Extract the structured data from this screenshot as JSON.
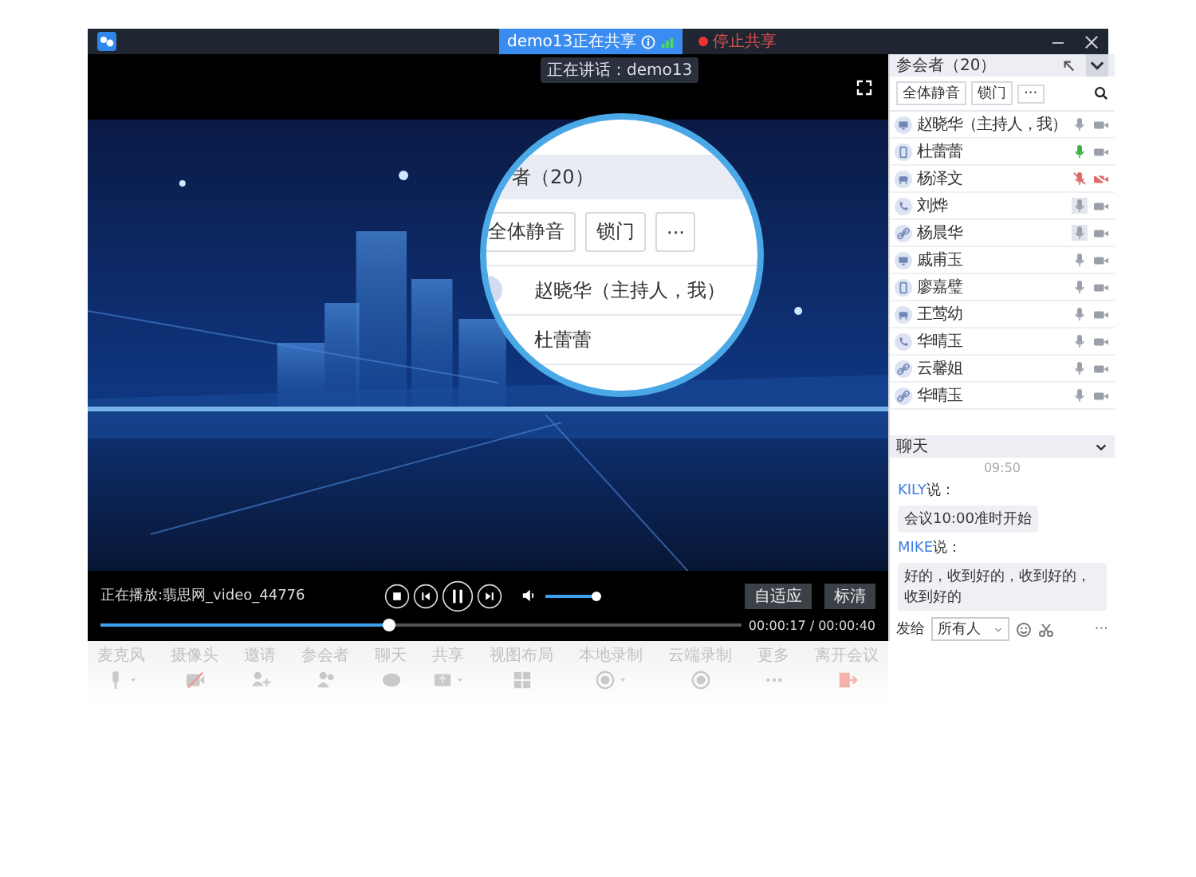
{
  "title_bar": {
    "sharing_label": "demo13正在共享",
    "tooltip": "正在讲话：demo13",
    "stop_share": "停止共享"
  },
  "video": {
    "now_playing": "正在播放:翡思网_video_44776",
    "progress": {
      "level": 0.45
    },
    "volume": {
      "level": 0.95
    },
    "time": "00:00:17 / 00:00:40",
    "buttons": [
      "自适应",
      "标清"
    ]
  },
  "magnifier": {
    "header": "者（20）",
    "buttons": [
      "全体静音",
      "锁门",
      "···"
    ],
    "rows": [
      "赵晓华（主持人，我）",
      "杜蕾蕾"
    ]
  },
  "toolbar": [
    {
      "label": "麦克风",
      "kind": "mic",
      "dropdown": true
    },
    {
      "label": "摄像头",
      "kind": "camera",
      "dropdown": false
    },
    {
      "label": "邀请",
      "kind": "invite",
      "dropdown": false
    },
    {
      "label": "参会者",
      "kind": "people",
      "dropdown": false
    },
    {
      "label": "聊天",
      "kind": "chat",
      "dropdown": false
    },
    {
      "label": "共享",
      "kind": "share",
      "dropdown": true
    },
    {
      "label": "视图布局",
      "kind": "layout",
      "dropdown": false
    },
    {
      "label": "本地录制",
      "kind": "record",
      "dropdown": true
    },
    {
      "label": "云端录制",
      "kind": "record",
      "dropdown": false
    },
    {
      "label": "更多",
      "kind": "more",
      "dropdown": false
    },
    {
      "label": "离开会议",
      "kind": "leave",
      "dropdown": false
    }
  ],
  "participants": {
    "title": "参会者（20）",
    "buttons": [
      "全体静音",
      "锁门",
      "···"
    ],
    "items": [
      {
        "name": "赵晓华（主持人，我）",
        "kind": "pc",
        "muted": false,
        "speaking": false,
        "highlighted": false,
        "camera_off": false
      },
      {
        "name": "杜蕾蕾",
        "kind": "mobile",
        "muted": false,
        "speaking": true,
        "highlighted": false,
        "camera_off": false
      },
      {
        "name": "杨泽文",
        "kind": "room",
        "muted": true,
        "speaking": false,
        "highlighted": false,
        "camera_off": true
      },
      {
        "name": "刘烨",
        "kind": "phone",
        "muted": false,
        "speaking": false,
        "highlighted": true,
        "camera_off": false
      },
      {
        "name": "杨晨华",
        "kind": "link",
        "muted": false,
        "speaking": false,
        "highlighted": true,
        "camera_off": false
      },
      {
        "name": "戚甫玉",
        "kind": "pc",
        "muted": false,
        "speaking": false,
        "highlighted": false,
        "camera_off": false
      },
      {
        "name": "廖嘉璧",
        "kind": "mobile",
        "muted": false,
        "speaking": false,
        "highlighted": false,
        "camera_off": false
      },
      {
        "name": "王莺幼",
        "kind": "room",
        "muted": false,
        "speaking": false,
        "highlighted": false,
        "camera_off": false
      },
      {
        "name": "华晴玉",
        "kind": "phone",
        "muted": false,
        "speaking": false,
        "highlighted": false,
        "camera_off": false
      },
      {
        "name": "云馨姐",
        "kind": "link",
        "muted": false,
        "speaking": false,
        "highlighted": false,
        "camera_off": false
      },
      {
        "name": "华晴玉",
        "kind": "link",
        "muted": false,
        "speaking": false,
        "highlighted": false,
        "camera_off": false
      }
    ]
  },
  "chat": {
    "title": "聊天",
    "time": "09:50",
    "messages": [
      {
        "sender": "KILY",
        "verb": "说：",
        "text": "会议10:00准时开始"
      },
      {
        "sender": "MIKE",
        "verb": "说：",
        "text": "好的，收到好的，收到好的，收到好的"
      }
    ],
    "send_to_label": "发给",
    "recipient": "所有人",
    "more": "···"
  }
}
